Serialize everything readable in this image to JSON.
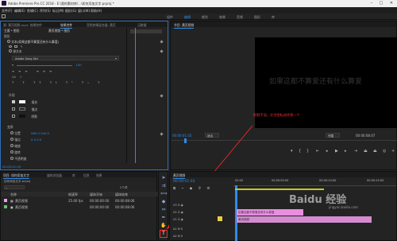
{
  "titlebar": {
    "title": "Adobe Premiere Pro CC 2018 - E:\\我的素材库\\...\\如何添加文字.prproj *",
    "min": "–",
    "max": "□",
    "close": "✕"
  },
  "menu": [
    "文件(F)",
    "编辑(E)",
    "剪辑(C)",
    "序列(S)",
    "标记(M)",
    "图形(G)",
    "窗口(W)",
    "帮助(H)"
  ],
  "workspaces": [
    "组件",
    "编辑",
    "颜色",
    "效果",
    "音频",
    "图形",
    "库"
  ],
  "effect_controls": {
    "tabs": [
      "源: 黄页视频.mp4: 效果控件",
      "效果控件",
      "音频剪辑混合器: 黄页",
      "元数据"
    ],
    "header_master": "主要 * 图形",
    "header_seq": "黄页视频 * 图形",
    "section_graphic": "图形",
    "section_video": "视频效果",
    "text_layer": "文本(如果这都不算爱还有什么算爱)",
    "source_text": "源文本",
    "font_name": "Adobe Song Std",
    "font_size": "100",
    "align_value": "0",
    "appearance": "外观",
    "fill": "填充",
    "stroke": "描边",
    "shadow": "阴影",
    "transform": "变换",
    "position": "位置",
    "position_val": "960.0  540.0",
    "anchor": "锚点",
    "anchor_val": "0.0  0.0",
    "scale": "缩放",
    "rotation": "旋转",
    "opacity": "不透明度",
    "timecode": "00:00:01:03"
  },
  "program_monitor": {
    "tab": "节目: 黄页视频",
    "overlay_text": "如果这都不算爱还有什么算爱",
    "annotation": "默默不语，文字图标选择第一个",
    "timecode": "00:00:01:03",
    "fit": "适合",
    "quality": "完整",
    "duration": "00:00:08:07"
  },
  "project": {
    "tabs": [
      "项目: 如何添加文字",
      "媒体浏览器",
      "库",
      "信息",
      "效果"
    ],
    "path": "如何添加文字.prproj",
    "count": "2个项",
    "columns": [
      "名称",
      "帧速率",
      "媒体开始",
      "媒体结束"
    ],
    "items": [
      {
        "name": "黄页视频",
        "fps": "25.00 fps",
        "start": "00:00:00:00",
        "end": "00:00:08:06",
        "color": "#e8a0e8"
      },
      {
        "name": "黄页视频",
        "fps": "",
        "start": "00:00:00:00",
        "end": "00:00:08:06",
        "color": "#66c266"
      }
    ]
  },
  "timeline": {
    "tab": "黄页视频",
    "timecode": "00:00:01:03",
    "ruler": [
      "00:00",
      "00:00:05:00",
      "00:00:10:00",
      "00:00:15:00"
    ],
    "tracks": [
      "V3",
      "V2",
      "V1",
      "A1",
      "A2"
    ],
    "clip_text": "如果这都不算爱还有什么算爱",
    "clip_video": "黄页视频",
    "watermark": "Baidu 经验",
    "watermark_sub": "jingyan.baidu.com"
  },
  "colors": {
    "accent": "#2d8ceb",
    "annotation_red": "#ff2a2a",
    "clip_pink": "#e88de0",
    "panel_bg": "#232323"
  }
}
